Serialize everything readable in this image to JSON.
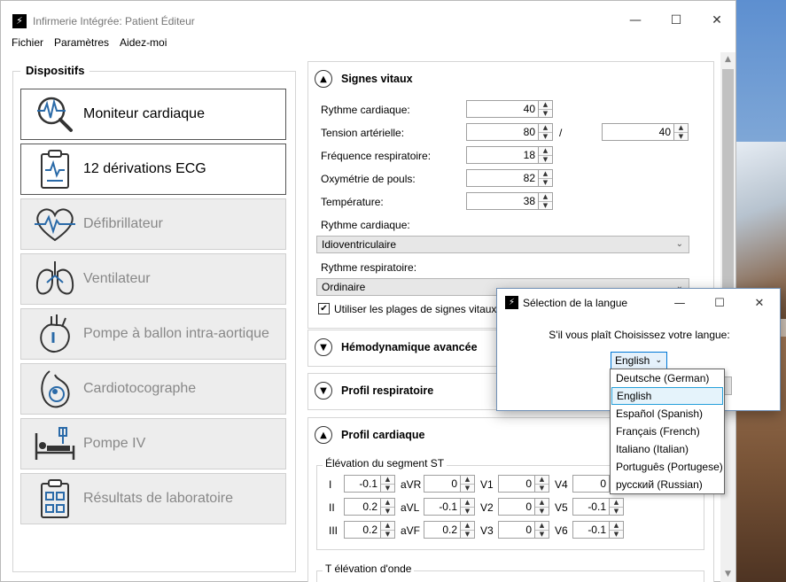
{
  "window": {
    "title": "Infirmerie Intégrée: Patient Éditeur",
    "menu": [
      "Fichier",
      "Paramètres",
      "Aidez-moi"
    ]
  },
  "devices": {
    "legend": "Dispositifs",
    "items": [
      {
        "label": "Moniteur cardiaque",
        "icon": "cardiac-monitor-icon"
      },
      {
        "label": "12 dérivations ECG",
        "icon": "ecg-clipboard-icon"
      },
      {
        "label": "Défibrillateur",
        "icon": "heart-pulse-icon"
      },
      {
        "label": "Ventilateur",
        "icon": "lungs-icon"
      },
      {
        "label": "Pompe à ballon intra-aortique",
        "icon": "anatomical-heart-icon"
      },
      {
        "label": "Cardiotocographe",
        "icon": "pregnancy-icon"
      },
      {
        "label": "Pompe IV",
        "icon": "hospital-bed-iv-icon"
      },
      {
        "label": "Résultats de laboratoire",
        "icon": "lab-checklist-icon"
      }
    ]
  },
  "vitals": {
    "title": "Signes vitaux",
    "heart_rate_label": "Rythme cardiaque:",
    "heart_rate": "40",
    "bp_label": "Tension artérielle:",
    "bp_systolic": "80",
    "bp_sep": "/",
    "bp_diastolic": "40",
    "resp_rate_label": "Fréquence respiratoire:",
    "resp_rate": "18",
    "spo2_label": "Oxymétrie de pouls:",
    "spo2": "82",
    "temp_label": "Température:",
    "temp": "38",
    "cardiac_rhythm_label": "Rythme cardiaque:",
    "cardiac_rhythm": "Idioventriculaire",
    "resp_rhythm_label": "Rythme respiratoire:",
    "resp_rhythm": "Ordinaire",
    "use_ranges_label": "Utiliser les plages de signes vitaux p",
    "use_ranges_checked": true
  },
  "sections": {
    "hemodynamics": "Hémodynamique avancée",
    "respiratory": "Profil respiratoire",
    "cardiac": "Profil cardiaque"
  },
  "st_elevation": {
    "legend": "Élévation du segment ST",
    "rows": [
      [
        {
          "lead": "I",
          "value": "-0.1"
        },
        {
          "lead": "aVR",
          "value": "0"
        },
        {
          "lead": "V1",
          "value": "0"
        },
        {
          "lead": "V4",
          "value": "0"
        }
      ],
      [
        {
          "lead": "II",
          "value": "0.2"
        },
        {
          "lead": "aVL",
          "value": "-0.1"
        },
        {
          "lead": "V2",
          "value": "0"
        },
        {
          "lead": "V5",
          "value": "-0.1"
        }
      ],
      [
        {
          "lead": "III",
          "value": "0.2"
        },
        {
          "lead": "aVF",
          "value": "0.2"
        },
        {
          "lead": "V3",
          "value": "0"
        },
        {
          "lead": "V6",
          "value": "-0.1"
        }
      ]
    ]
  },
  "t_wave": {
    "legend": "T élévation d'onde"
  },
  "language_dialog": {
    "title": "Sélection de la langue",
    "prompt": "S'il vous plaît Choisissez votre langue:",
    "selected": "English",
    "options": [
      "Deutsche (German)",
      "English",
      "Español (Spanish)",
      "Français (French)",
      "Italiano (Italian)",
      "Português (Portugese)",
      "русский (Russian)"
    ]
  },
  "colors": {
    "icon_blue": "#2a6aa8",
    "selection_border": "#26a0da",
    "focus_blue": "#0078d7"
  }
}
